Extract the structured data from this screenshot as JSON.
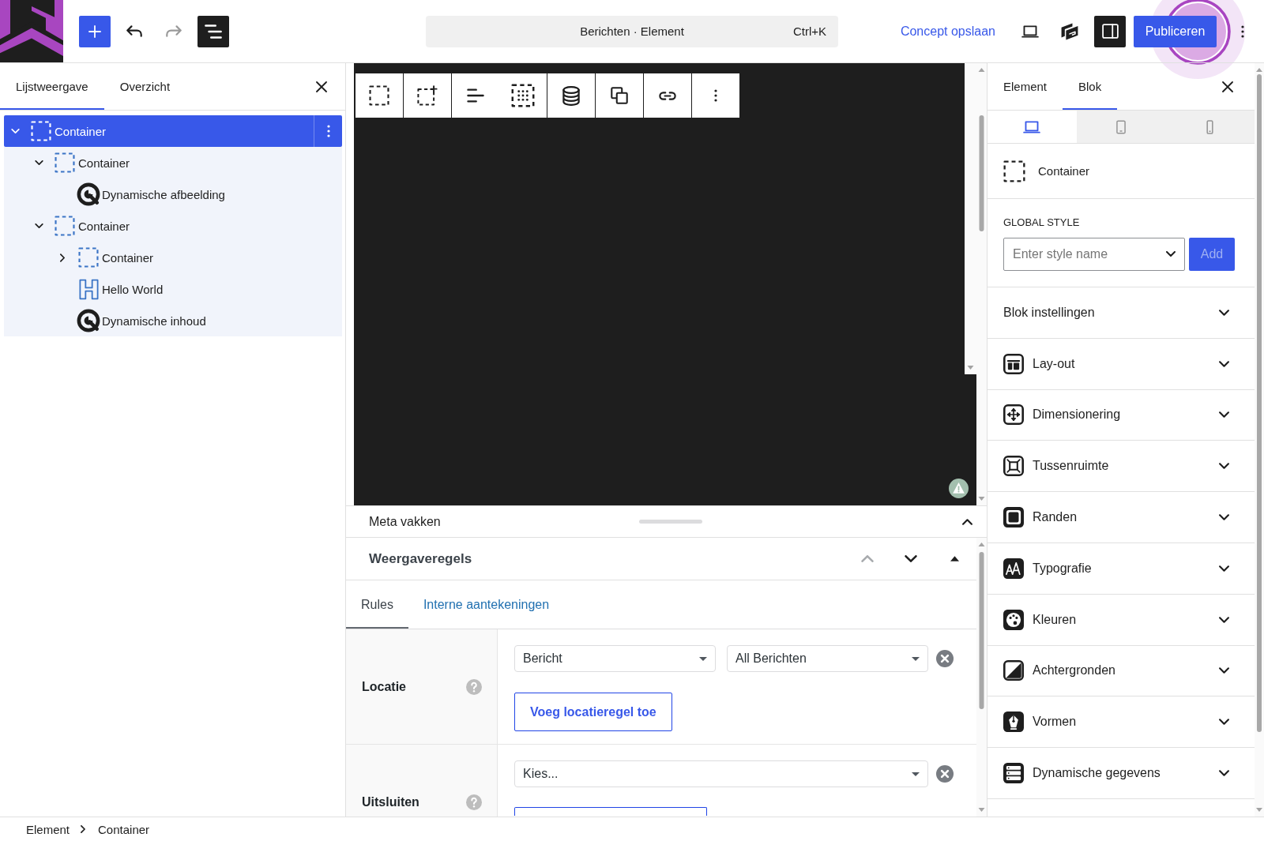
{
  "top_bar": {
    "undo": {
      "disabled": false
    },
    "redo": {
      "disabled": true
    },
    "list_view": {
      "on": true
    },
    "command_bar": {
      "label": "Berichten · Element",
      "shortcut": "Ctrl+K"
    },
    "save_draft": "Concept opslaan",
    "settings": {
      "on": true
    },
    "publish": "Publiceren"
  },
  "list_panel": {
    "tabs": [
      {
        "label": "Lijstweergave",
        "selected": true
      },
      {
        "label": "Overzicht",
        "selected": false
      }
    ],
    "tree": [
      {
        "label": "Container",
        "kind": "container",
        "selected": true,
        "expanded": true,
        "children": [
          {
            "label": "Container",
            "kind": "container",
            "selected": false,
            "expanded": true,
            "children": [
              {
                "label": "Dynamische afbeelding",
                "kind": "dynamic",
                "selected": false
              }
            ]
          },
          {
            "label": "Container",
            "kind": "container",
            "selected": false,
            "expanded": true,
            "children": [
              {
                "label": "Container",
                "kind": "container",
                "selected": false,
                "expanded": false
              },
              {
                "label": "Hello World",
                "kind": "heading",
                "selected": false
              },
              {
                "label": "Dynamische inhoud",
                "kind": "dynamic",
                "selected": false
              }
            ]
          }
        ]
      }
    ]
  },
  "meta_boxes": {
    "title": "Meta vakken",
    "expanded": true,
    "panel": {
      "title": "Weergaveregels",
      "move_up": {
        "disabled": true
      },
      "move_down": {
        "disabled": false
      },
      "expanded": true,
      "tabs": [
        {
          "label": "Rules",
          "selected": true
        },
        {
          "label": "Interne aantekeningen",
          "selected": false
        }
      ],
      "rules": [
        {
          "label": "Locatie",
          "fields": [
            {
              "value": "Bericht"
            },
            {
              "value": "All Berichten"
            }
          ],
          "add_button": "Voeg locatieregel toe"
        },
        {
          "label": "Uitsluiten",
          "fields": [
            {
              "value": "Kies..."
            }
          ],
          "add_button_clipped": true
        }
      ]
    }
  },
  "block_settings": {
    "tabs": [
      {
        "label": "Element",
        "selected": false
      },
      {
        "label": "Blok",
        "selected": true
      }
    ],
    "devices": [
      {
        "kind": "desktop",
        "selected": true
      },
      {
        "kind": "tablet",
        "selected": false
      },
      {
        "kind": "mobile",
        "selected": false
      }
    ],
    "block": {
      "kind": "container",
      "label": "Container"
    },
    "global_style": {
      "label": "GLOBAL STYLE",
      "placeholder": "Enter style name",
      "button": {
        "label": "Add",
        "disabled": true
      }
    },
    "sections": [
      {
        "label": "Blok instellingen",
        "kind": "plain",
        "expanded": false
      },
      {
        "label": "Lay-out",
        "kind": "layout",
        "expanded": false
      },
      {
        "label": "Dimensionering",
        "kind": "sizing",
        "expanded": false
      },
      {
        "label": "Tussenruimte",
        "kind": "spacing",
        "expanded": false
      },
      {
        "label": "Randen",
        "kind": "borders",
        "expanded": false
      },
      {
        "label": "Typografie",
        "kind": "typography",
        "expanded": false
      },
      {
        "label": "Kleuren",
        "kind": "colors",
        "expanded": false
      },
      {
        "label": "Achtergronden",
        "kind": "backgrounds",
        "expanded": false
      },
      {
        "label": "Vormen",
        "kind": "shapes",
        "expanded": false
      },
      {
        "label": "Dynamische gegevens",
        "kind": "dynamic_data",
        "expanded": false
      }
    ]
  },
  "breadcrumb": [
    {
      "label": "Element"
    },
    {
      "label": "Container"
    }
  ]
}
